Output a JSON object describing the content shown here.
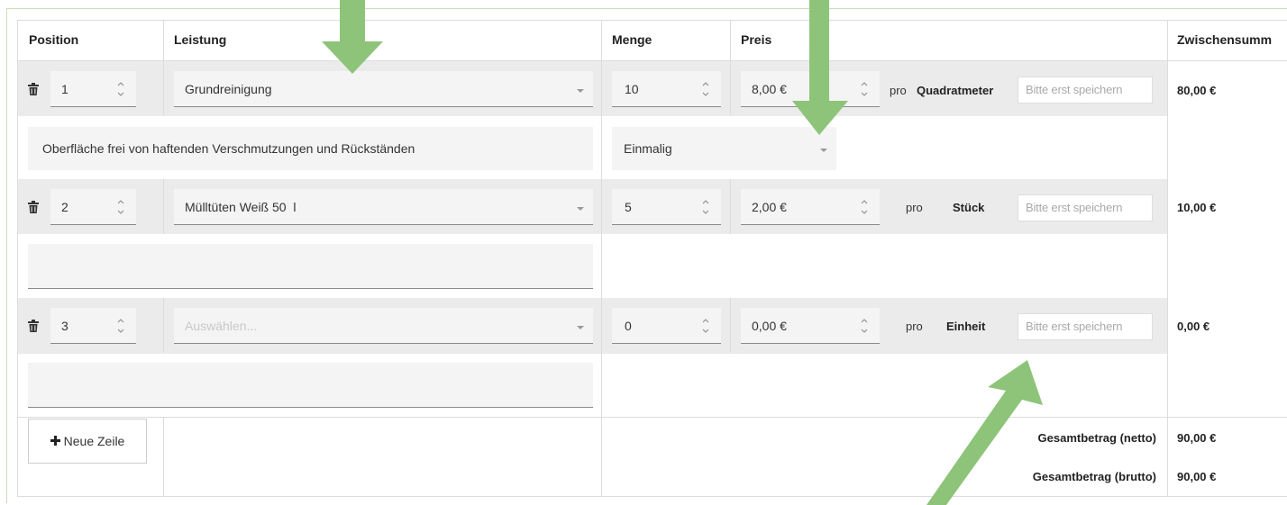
{
  "columns": {
    "position": "Position",
    "leistung": "Leistung",
    "menge": "Menge",
    "preis": "Preis",
    "zwischensumme": "Zwischensumm"
  },
  "rows": [
    {
      "position": "1",
      "service": "Grundreinigung",
      "service_is_placeholder": false,
      "quantity": "10",
      "price": "8,00 €",
      "per": "pro",
      "unit": "Quadratmeter",
      "save_hint": "Bitte erst speichern",
      "subtotal": "80,00 €",
      "description": "Oberfläche frei von haftenden Verschmutzungen und Rückständen",
      "frequency": "Einmalig"
    },
    {
      "position": "2",
      "service": "Mülltüten Weiß 50  l",
      "service_is_placeholder": false,
      "quantity": "5",
      "price": "2,00 €",
      "per": "pro",
      "unit": "Stück",
      "save_hint": "Bitte erst speichern",
      "subtotal": "10,00 €",
      "description": ""
    },
    {
      "position": "3",
      "service": "Auswählen...",
      "service_is_placeholder": true,
      "quantity": "0",
      "price": "0,00 €",
      "per": "pro",
      "unit": "Einheit",
      "save_hint": "Bitte erst speichern",
      "subtotal": "0,00 €",
      "description": ""
    }
  ],
  "add_row_button": {
    "icon": "plus-icon",
    "label": "Neue Zeile"
  },
  "totals": {
    "net_label": "Gesamtbetrag (netto)",
    "net_value": "90,00 €",
    "gross_label": "Gesamtbetrag (brutto)",
    "gross_value": "90,00 €"
  },
  "colors": {
    "arrow": "#8ec47a",
    "row_bg": "#ebebeb",
    "field_bg": "#f4f4f4"
  }
}
